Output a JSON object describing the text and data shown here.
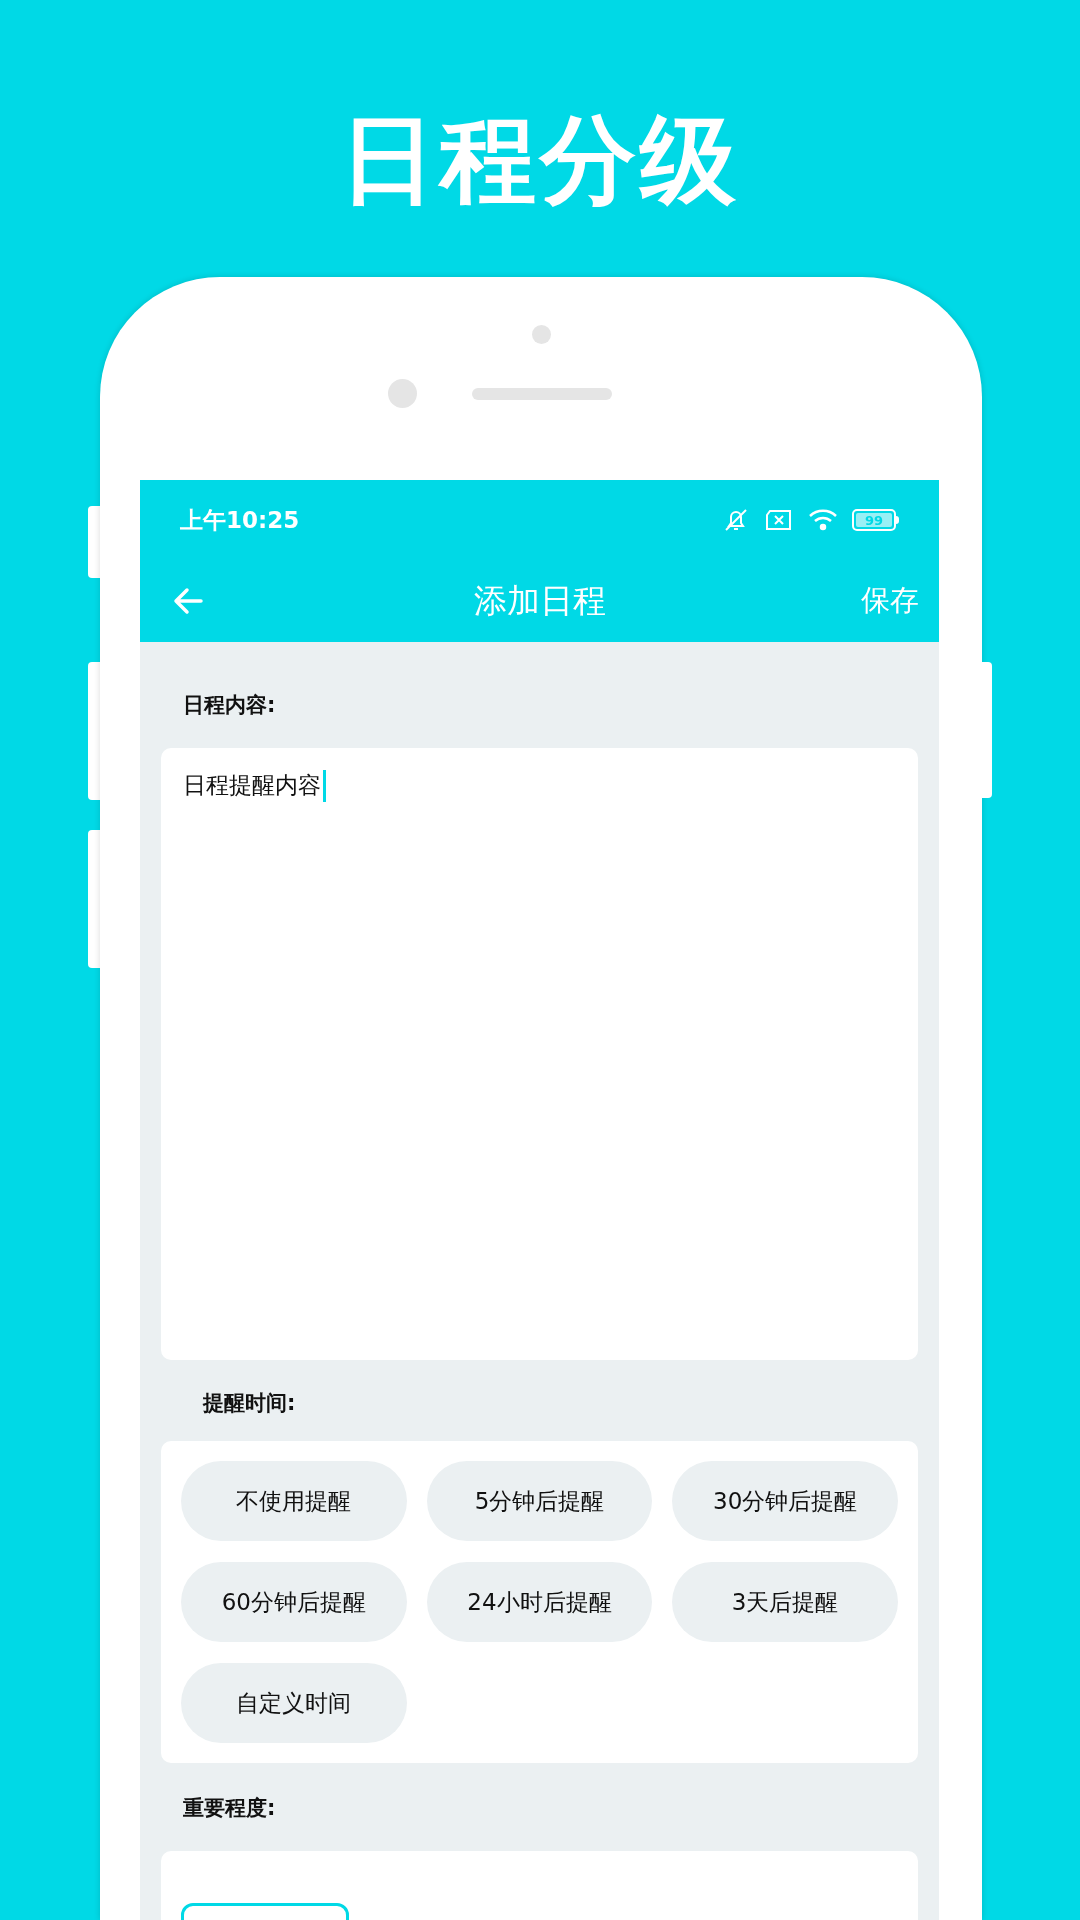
{
  "headline": "日程分级",
  "status_bar": {
    "time": "上午10:25",
    "battery": "99"
  },
  "nav_bar": {
    "title": "添加日程",
    "action": "保存"
  },
  "content_section": {
    "label": "日程内容:",
    "value": "日程提醒内容"
  },
  "reminder_section": {
    "label": "提醒时间:",
    "options": [
      {
        "label": "不使用提醒"
      },
      {
        "label": "5分钟后提醒"
      },
      {
        "label": "30分钟后提醒"
      },
      {
        "label": "60分钟后提醒"
      },
      {
        "label": "24小时后提醒"
      },
      {
        "label": "3天后提醒"
      },
      {
        "label": "自定义时间"
      }
    ]
  },
  "importance_section": {
    "label": "重要程度:"
  }
}
